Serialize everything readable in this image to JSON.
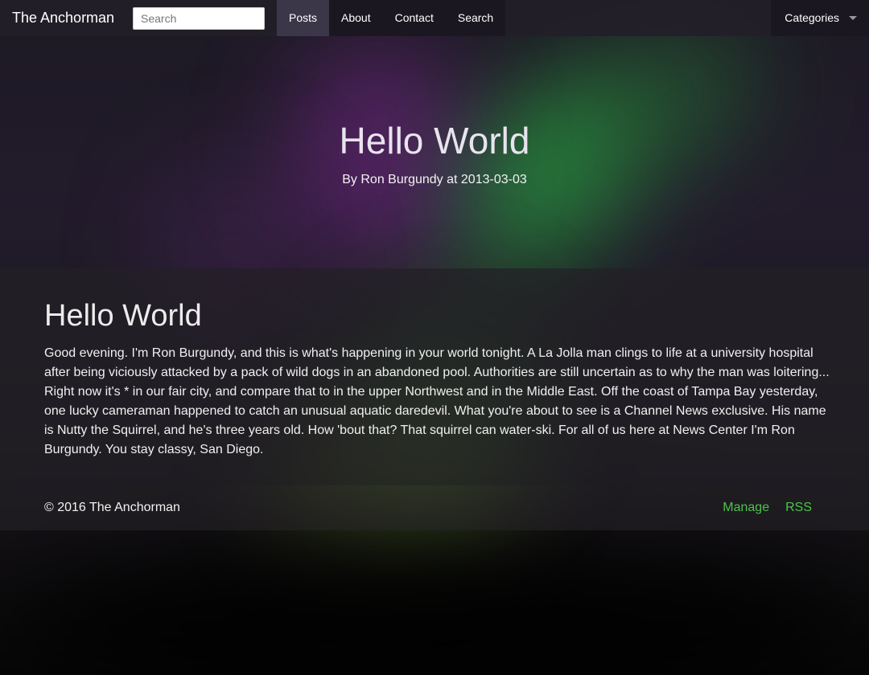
{
  "navbar": {
    "brand": "The Anchorman",
    "search_placeholder": "Search",
    "links": [
      {
        "label": "Posts",
        "active": true
      },
      {
        "label": "About",
        "active": false
      },
      {
        "label": "Contact",
        "active": false
      },
      {
        "label": "Search",
        "active": false
      }
    ],
    "categories_label": "Categories"
  },
  "hero": {
    "title": "Hello World",
    "byline": "By Ron Burgundy at 2013-03-03"
  },
  "article": {
    "title": "Hello World",
    "body": "Good evening. I'm Ron Burgundy, and this is what's happening in your world tonight. A La Jolla man clings to life at a university hospital after being viciously attacked by a pack of wild dogs in an abandoned pool. Authorities are still uncertain as to why the man was loitering... Right now it's * in our fair city, and compare that to in the upper Northwest and in the Middle East. Off the coast of Tampa Bay yesterday, one lucky cameraman happened to catch an unusual aquatic daredevil. What you're about to see is a Channel News exclusive. His name is Nutty the Squirrel, and he's three years old. How 'bout that? That squirrel can water-ski. For all of us here at News Center I'm Ron Burgundy. You stay classy, San Diego."
  },
  "footer": {
    "copyright": "© 2016 The Anchorman",
    "links": [
      "Manage",
      "RSS"
    ]
  },
  "colors": {
    "link_green": "#4cc34a",
    "navbar_bg": "#231e28"
  }
}
